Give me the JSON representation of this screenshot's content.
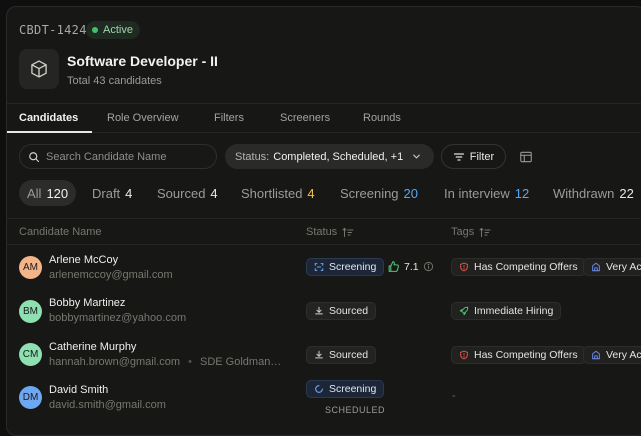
{
  "job": {
    "id": "CBDT-1424",
    "status": "Active",
    "title": "Software Developer - II",
    "subtitle": "Total 43 candidates",
    "icon": "cube-icon"
  },
  "tabs": [
    {
      "label": "Candidates",
      "active": true
    },
    {
      "label": "Role Overview",
      "active": false
    },
    {
      "label": "Filters",
      "active": false
    },
    {
      "label": "Screeners",
      "active": false
    },
    {
      "label": "Rounds",
      "active": false
    }
  ],
  "toolbar": {
    "search_placeholder": "Search Candidate Name",
    "status_filter_prefix": "Status:",
    "status_filter_value": "Completed, Scheduled, +1",
    "filter_label": "Filter"
  },
  "stages": [
    {
      "label": "All",
      "count": "120",
      "active": true,
      "count_color": "#f2f2f0"
    },
    {
      "label": "Draft",
      "count": "4",
      "active": false,
      "count_color": "#e8e8e6"
    },
    {
      "label": "Sourced",
      "count": "4",
      "active": false,
      "count_color": "#e8e8e6"
    },
    {
      "label": "Shortlisted",
      "count": "4",
      "active": false,
      "count_color": "#f2c14e"
    },
    {
      "label": "Screening",
      "count": "20",
      "active": false,
      "count_color": "#5aa7f0"
    },
    {
      "label": "In interview",
      "count": "12",
      "active": false,
      "count_color": "#5aa7f0"
    },
    {
      "label": "Withdrawn",
      "count": "22",
      "active": false,
      "count_color": "#e8e8e6"
    }
  ],
  "columns": {
    "name": "Candidate Name",
    "status": "Status",
    "tags": "Tags"
  },
  "candidates": [
    {
      "initials": "AM",
      "avatar_color": "#f3b48a",
      "name": "Arlene McCoy",
      "email": "arlenemccoy@gmail.com",
      "extra": "",
      "status": "Screening",
      "status_kind": "screening",
      "score": "7.1",
      "scheduled": "",
      "tags": [
        "Has Competing Offers",
        "Very Active"
      ]
    },
    {
      "initials": "BM",
      "avatar_color": "#8fe0b0",
      "name": "Bobby Martinez",
      "email": "bobbymartinez@yahoo.com",
      "extra": "",
      "status": "Sourced",
      "status_kind": "sourced",
      "score": "",
      "scheduled": "",
      "tags": [
        "Immediate Hiring"
      ]
    },
    {
      "initials": "CM",
      "avatar_color": "#8fe0b0",
      "name": "Catherine Murphy",
      "email": "hannah.brown@gmail.com",
      "extra": "SDE Goldman…",
      "status": "Sourced",
      "status_kind": "sourced",
      "score": "",
      "scheduled": "",
      "tags": [
        "Has Competing Offers",
        "Very Active"
      ]
    },
    {
      "initials": "DM",
      "avatar_color": "#6fa8f2",
      "name": "David Smith",
      "email": "david.smith@gmail.com",
      "extra": "",
      "status": "Screening",
      "status_kind": "screening-scheduled",
      "score": "",
      "scheduled": "SCHEDULED",
      "tags": []
    }
  ],
  "empty_tag": "-",
  "colors": {
    "active_green": "#3fc26a",
    "screening_blue": "#5aa7f0",
    "shortlisted_yellow": "#f2c14e",
    "offer_red": "#e5534b",
    "hiring_green": "#52c27a",
    "active_blue": "#6f8ff0"
  }
}
